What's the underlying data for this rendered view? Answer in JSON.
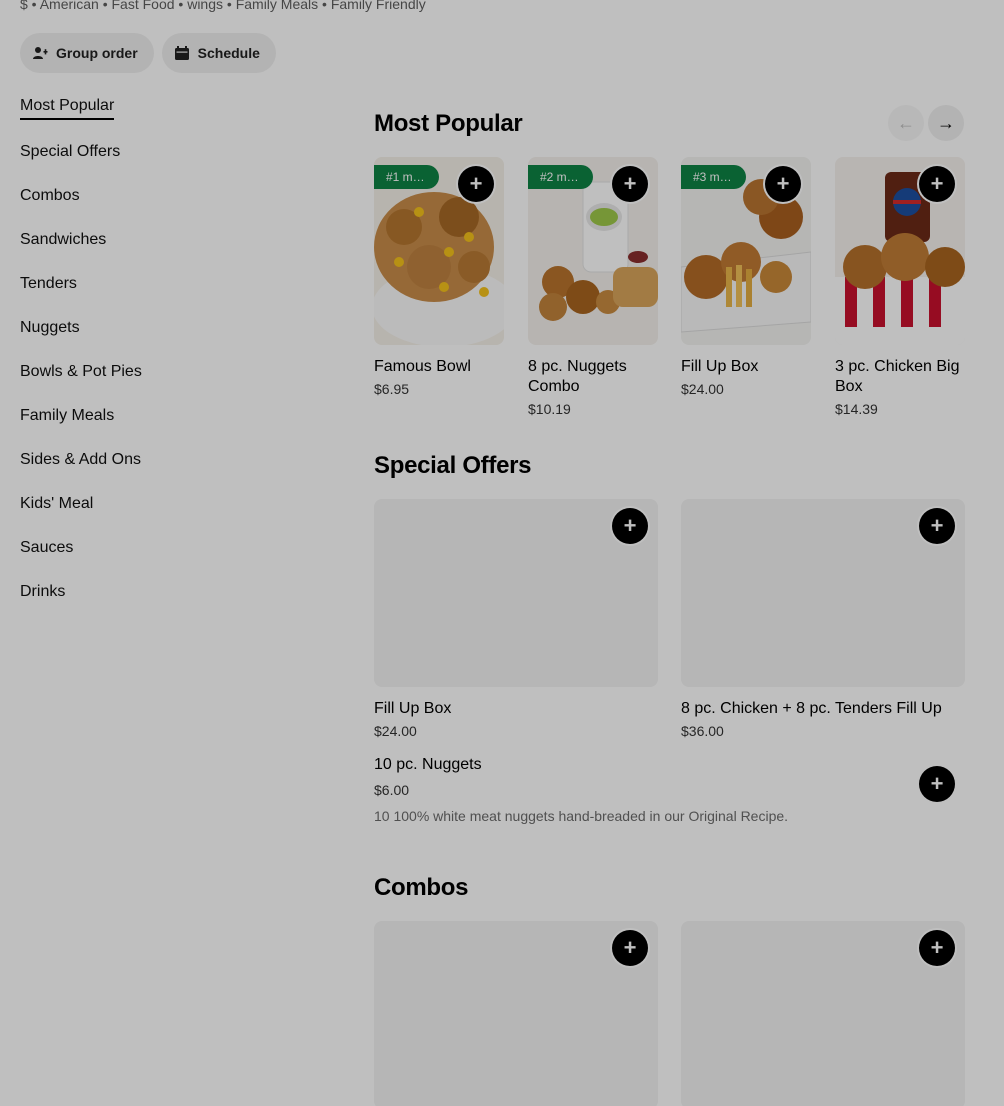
{
  "meta_line": "$ • American • Fast Food • wings • Family Meals • Family Friendly",
  "actions": {
    "group_order": "Group order",
    "schedule": "Schedule"
  },
  "sidebar": {
    "items": [
      {
        "label": "Most Popular",
        "active": true
      },
      {
        "label": "Special Offers"
      },
      {
        "label": "Combos"
      },
      {
        "label": "Sandwiches"
      },
      {
        "label": "Tenders"
      },
      {
        "label": "Nuggets"
      },
      {
        "label": "Bowls & Pot Pies"
      },
      {
        "label": "Family Meals"
      },
      {
        "label": "Sides & Add Ons"
      },
      {
        "label": "Kids' Meal"
      },
      {
        "label": "Sauces"
      },
      {
        "label": "Drinks"
      }
    ]
  },
  "most_popular": {
    "title": "Most Popular",
    "items": [
      {
        "badge": "#1 m…",
        "name": "Famous Bowl",
        "price": "$6.95"
      },
      {
        "badge": "#2 m…",
        "name": "8 pc. Nuggets Combo",
        "price": "$10.19"
      },
      {
        "badge": "#3 m…",
        "name": "Fill Up Box",
        "price": "$24.00"
      },
      {
        "badge": "",
        "name": "3 pc. Chicken Big Box",
        "price": "$14.39"
      }
    ]
  },
  "special_offers": {
    "title": "Special Offers",
    "items": [
      {
        "name": "Fill Up Box",
        "price": "$24.00"
      },
      {
        "name": "8 pc. Chicken + 8 pc. Tenders Fill Up",
        "price": "$36.00"
      }
    ],
    "list_item": {
      "name": "10 pc. Nuggets",
      "price": "$6.00",
      "desc": "10 100% white meat nuggets hand-breaded in our Original Recipe."
    }
  },
  "combos": {
    "title": "Combos"
  },
  "icons": {
    "add": "plus-icon",
    "prev": "arrow-left-icon",
    "next": "arrow-right-icon",
    "group": "person-add-icon",
    "schedule": "calendar-icon"
  },
  "colors": {
    "badge_green": "#0e8345",
    "add_button": "#000000",
    "dim_overlay": "rgba(0,0,0,0.25)"
  }
}
